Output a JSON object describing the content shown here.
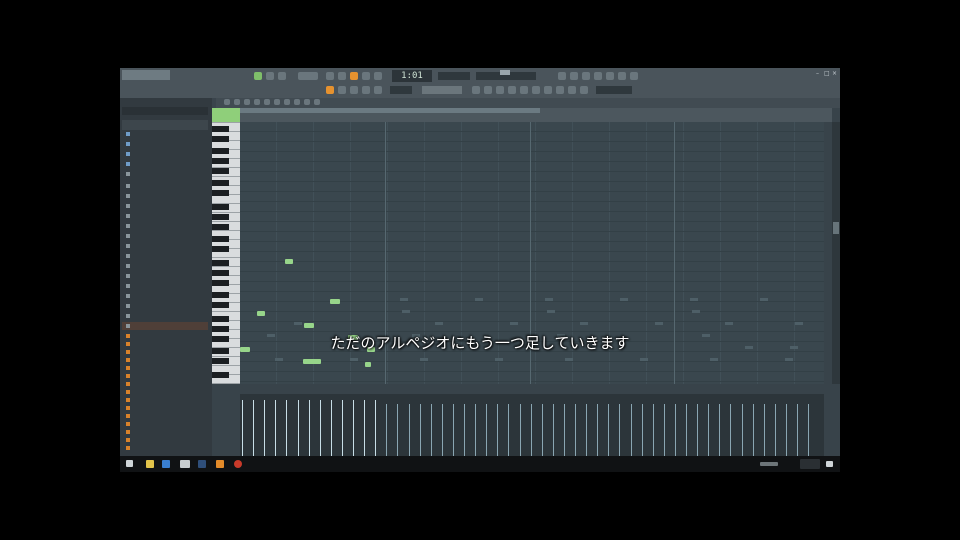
{
  "toolbar": {
    "time": "1:01"
  },
  "subtitle": "ただのアルペジオにもう一つ足していきます",
  "colors": {
    "accent": "#e6922f",
    "note": "#97d58a",
    "background": "#3a444c"
  },
  "browser_items": [
    {
      "label": "",
      "type": "folder"
    },
    {
      "label": "",
      "type": "folder"
    },
    {
      "label": "",
      "type": "folder"
    },
    {
      "label": "",
      "type": "folder"
    },
    {
      "label": "",
      "type": "folder"
    },
    {
      "label": "",
      "type": "folder"
    },
    {
      "label": "",
      "type": "folder"
    },
    {
      "label": "",
      "type": "folder"
    },
    {
      "label": "",
      "type": "folder"
    }
  ]
}
